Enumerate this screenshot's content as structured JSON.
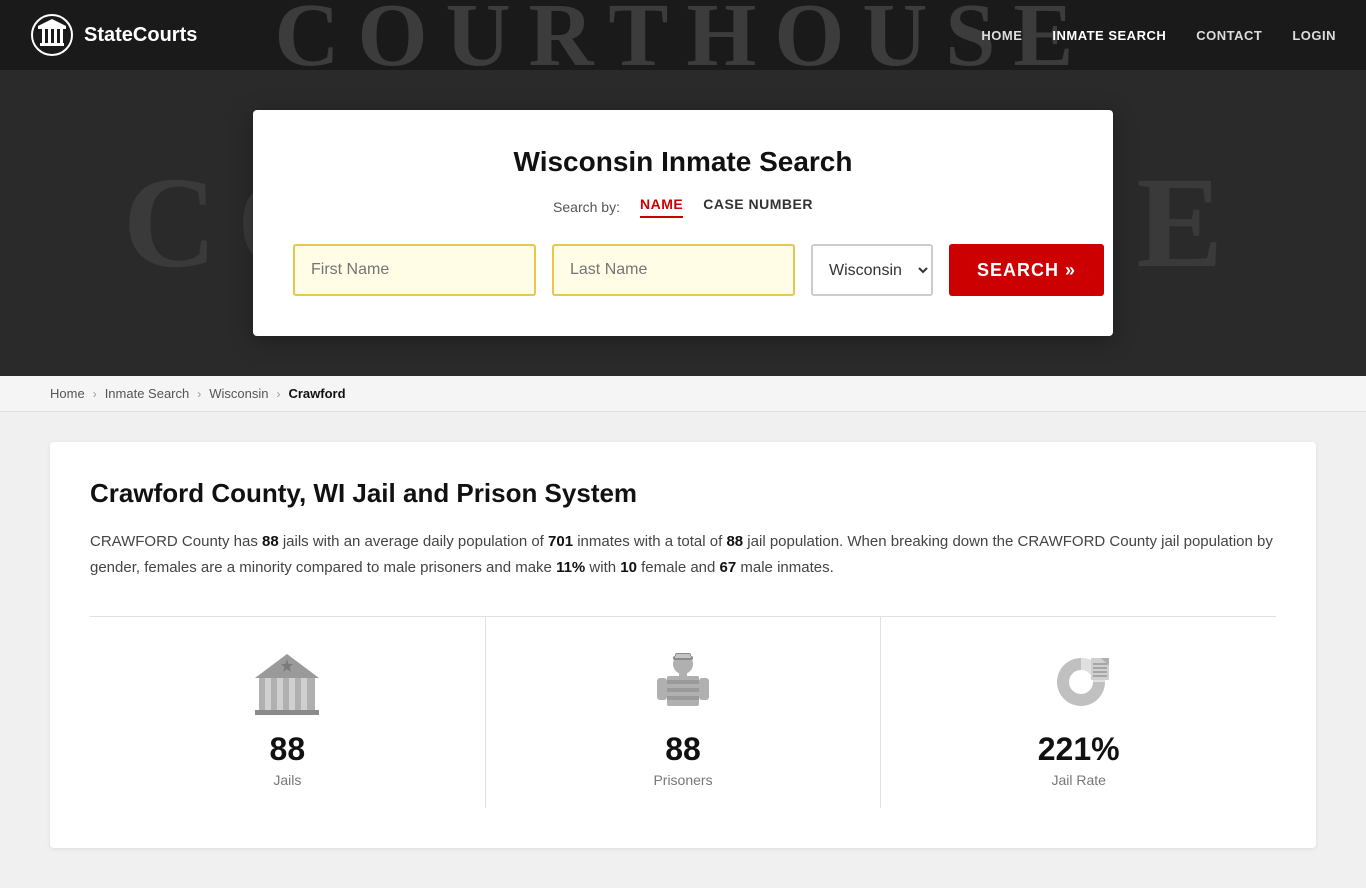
{
  "header": {
    "logo_text": "StateCourts",
    "courthouse_bg": "COURTHOUSE",
    "nav": [
      {
        "label": "HOME",
        "id": "home"
      },
      {
        "label": "INMATE SEARCH",
        "id": "inmate-search"
      },
      {
        "label": "CONTACT",
        "id": "contact"
      },
      {
        "label": "LOGIN",
        "id": "login"
      }
    ]
  },
  "hero": {
    "bg_text": "COURTHOUSE",
    "search_card": {
      "title": "Wisconsin Inmate Search",
      "search_by_label": "Search by:",
      "tabs": [
        {
          "label": "NAME",
          "active": true
        },
        {
          "label": "CASE NUMBER",
          "active": false
        }
      ],
      "first_name_placeholder": "First Name",
      "last_name_placeholder": "Last Name",
      "state_value": "Wisconsin",
      "search_btn_label": "SEARCH »"
    }
  },
  "breadcrumb": {
    "items": [
      {
        "label": "Home",
        "active": false
      },
      {
        "label": "Inmate Search",
        "active": false
      },
      {
        "label": "Wisconsin",
        "active": false
      },
      {
        "label": "Crawford",
        "active": true
      }
    ]
  },
  "content": {
    "title": "Crawford County, WI Jail and Prison System",
    "description_parts": [
      {
        "text": "CRAWFORD County has ",
        "bold": false
      },
      {
        "text": "88",
        "bold": true
      },
      {
        "text": " jails with an average daily population of ",
        "bold": false
      },
      {
        "text": "701",
        "bold": true
      },
      {
        "text": " inmates with a total of ",
        "bold": false
      },
      {
        "text": "88",
        "bold": true
      },
      {
        "text": " jail population. When breaking down the CRAWFORD County jail population by gender, females are a minority compared to male prisoners and make ",
        "bold": false
      },
      {
        "text": "11%",
        "bold": true
      },
      {
        "text": " with ",
        "bold": false
      },
      {
        "text": "10",
        "bold": true
      },
      {
        "text": " female and ",
        "bold": false
      },
      {
        "text": "67",
        "bold": true
      },
      {
        "text": " male inmates.",
        "bold": false
      }
    ],
    "stats": [
      {
        "number": "88",
        "label": "Jails",
        "icon": "jails"
      },
      {
        "number": "88",
        "label": "Prisoners",
        "icon": "prisoners"
      },
      {
        "number": "221%",
        "label": "Jail Rate",
        "icon": "jail-rate"
      }
    ]
  }
}
